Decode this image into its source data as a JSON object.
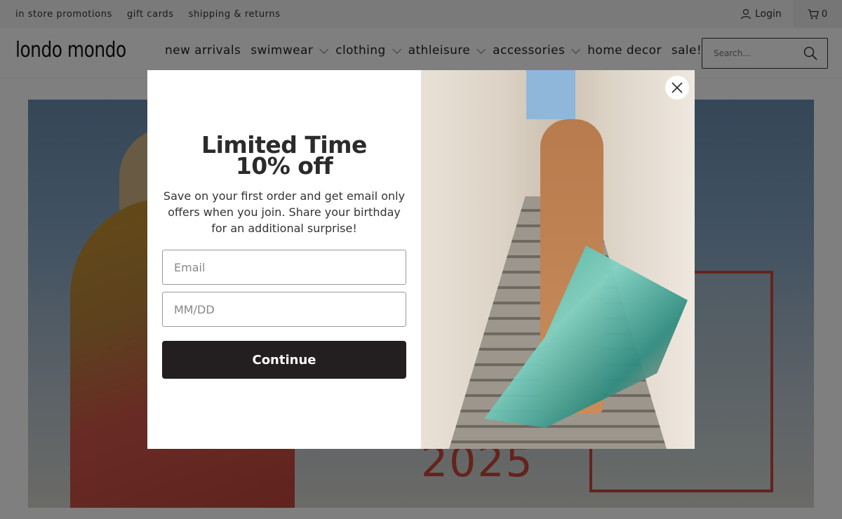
{
  "topbar": {
    "links": [
      "in store promotions",
      "gift cards",
      "shipping & returns"
    ],
    "login_label": "Login",
    "cart_count": "0"
  },
  "header": {
    "logo": "londo mondo",
    "nav": [
      {
        "label": "new arrivals",
        "dropdown": false
      },
      {
        "label": "swimwear",
        "dropdown": true
      },
      {
        "label": "clothing",
        "dropdown": true
      },
      {
        "label": "athleisure",
        "dropdown": true
      },
      {
        "label": "accessories",
        "dropdown": true
      },
      {
        "label": "home decor",
        "dropdown": false
      },
      {
        "label": "sale!",
        "dropdown": false
      }
    ],
    "search_placeholder": "Search..."
  },
  "hero": {
    "year_text": "2025"
  },
  "popup": {
    "headline_line1": "Limited Time",
    "headline_line2": "10% off",
    "description": "Save on your first order and get email only offers when you join. Share your birthday for an additional surprise!",
    "email_placeholder": "Email",
    "birthday_placeholder": "MM/DD",
    "continue_label": "Continue"
  },
  "icons": {
    "user": "user-icon",
    "cart": "cart-icon",
    "search": "search-icon",
    "close": "close-icon",
    "chevron": "chevron-down-icon"
  },
  "colors": {
    "accent_red": "#c9473b",
    "button_dark": "#231f20",
    "overlay": "rgba(0,0,0,0.5)"
  }
}
